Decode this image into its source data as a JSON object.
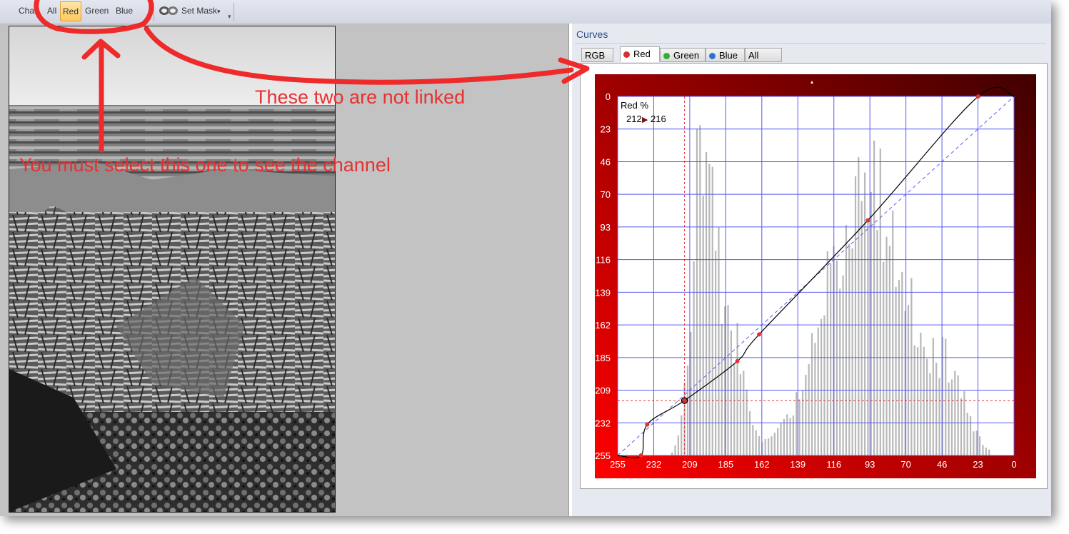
{
  "toolbar": {
    "chan_label": "Chan",
    "all_label": "All",
    "red_label": "Red",
    "green_label": "Green",
    "blue_label": "Blue",
    "set_mask_label": "Set Mask",
    "dropdown_glyph": "▾"
  },
  "panel": {
    "title": "Curves",
    "tabs": [
      {
        "label": "RGB",
        "dot": ""
      },
      {
        "label": "Red",
        "dot": "#d63030"
      },
      {
        "label": "Green",
        "dot": "#2fae2f"
      },
      {
        "label": "Blue",
        "dot": "#2f6fd6"
      },
      {
        "label": "All",
        "dot": ""
      }
    ]
  },
  "curve": {
    "readout_label": "Red %",
    "readout_in": "212",
    "readout_out": "216",
    "readout_arrow": "▶",
    "x_ticks": [
      "255",
      "232",
      "209",
      "185",
      "162",
      "139",
      "116",
      "93",
      "70",
      "46",
      "23",
      "0"
    ],
    "y_ticks": [
      "0",
      "23",
      "46",
      "70",
      "93",
      "116",
      "139",
      "162",
      "185",
      "209",
      "232",
      "255"
    ],
    "grid_color": "#5a5af0",
    "gradient_dark": "#400000",
    "gradient_bright": "#ff0000",
    "histogram_color": "#b8b8b8",
    "point_color": "#e03030",
    "control_points": [
      [
        240,
        255
      ],
      [
        236,
        233
      ],
      [
        212,
        216
      ],
      [
        178,
        188
      ],
      [
        164,
        169
      ],
      [
        94,
        88
      ],
      [
        23,
        0
      ]
    ]
  },
  "annotations": {
    "not_linked": "These two are not linked",
    "must_select": "You must select this one to see the channel",
    "color": "#e83030"
  }
}
